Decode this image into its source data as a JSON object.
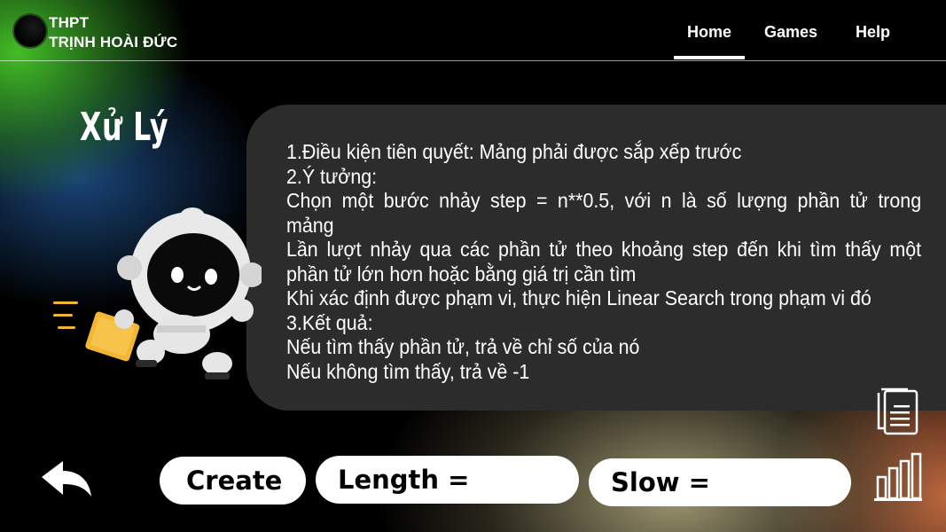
{
  "header": {
    "school_line1": "THPT",
    "school_line2": "TRỊNH HOÀI ĐỨC",
    "nav": {
      "home": "Home",
      "games": "Games",
      "help": "Help"
    },
    "active_nav": "Home"
  },
  "main": {
    "title": "Xử Lý",
    "content_lines": [
      "1.Điều kiện tiên quyết: Mảng phải được sắp xếp trước",
      "2.Ý tưởng:",
      "Chọn một bước nhảy step = n**0.5, với n là số lượng phần tử trong",
      "mảng",
      "Lần lượt nhảy qua các phần tử theo khoảng step đến khi tìm thấy một",
      "phần tử lớn hơn hoặc bằng giá trị cần tìm",
      "Khi xác định được phạm vi, thực hiện Linear Search trong phạm vi đó",
      "3.Kết quả:",
      "Nếu tìm thấy phần tử, trả về chỉ số của nó",
      "Nếu không tìm thấy, trả về -1"
    ]
  },
  "controls": {
    "create_label": "Create",
    "length_label": "Length =",
    "slow_label": "Slow ="
  },
  "icons": {
    "back": "back-arrow-icon",
    "document": "document-icon",
    "chart": "bar-chart-icon",
    "logo": "school-logo"
  },
  "colors": {
    "background": "#000000",
    "panel": "#2c2c2c",
    "accent_green": "#46c828",
    "accent_orange": "#e67846",
    "robot_box": "#f2b632"
  }
}
